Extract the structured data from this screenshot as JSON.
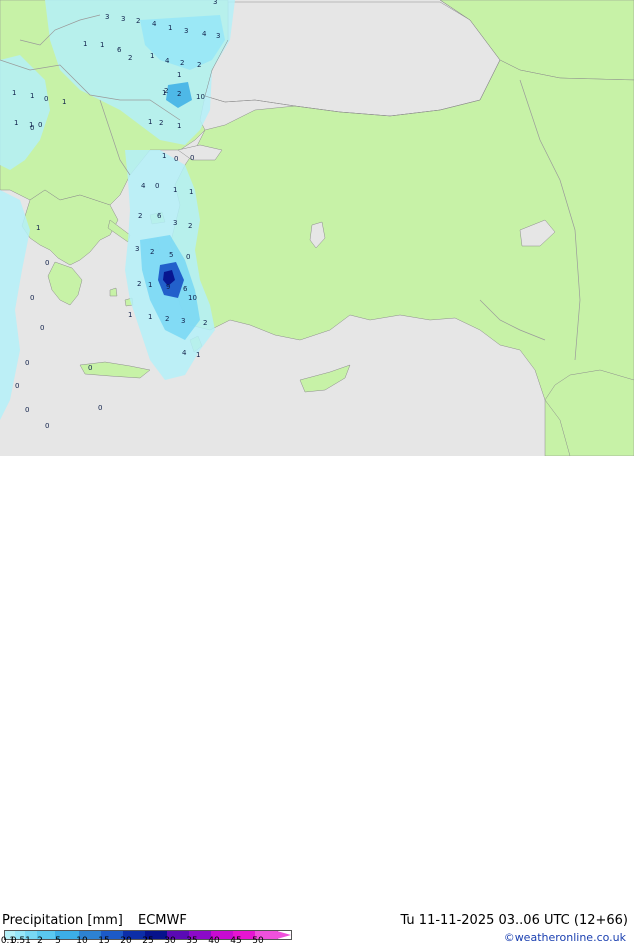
{
  "footer": {
    "title": "Precipitation [mm]",
    "model": "ECMWF",
    "valid": "Tu 11-11-2025 03..06 UTC (12+66)",
    "credit": "©weatheronline.co.uk"
  },
  "legend": {
    "ticks": [
      "0.1",
      "0.5",
      "1",
      "2",
      "5",
      "10",
      "15",
      "20",
      "25",
      "30",
      "35",
      "40",
      "45",
      "50"
    ],
    "colors": [
      "#b4f0f8",
      "#96e6f8",
      "#78d7f4",
      "#5ac8f0",
      "#3caee6",
      "#2d82d2",
      "#1c5ac8",
      "#0c2ea8",
      "#06128c",
      "#5a0ab4",
      "#8c0ac8",
      "#c80ad2",
      "#e614d2",
      "#f050dc"
    ]
  },
  "map_colors": {
    "sea": "#e6e6e6",
    "land": "#c7f2a7",
    "border": "#9a9a9a",
    "coast": "#8c8c8c"
  },
  "precip_values": [
    "3",
    "3",
    "2",
    "4",
    "1",
    "3",
    "4",
    "3",
    "3",
    "1",
    "1",
    "6",
    "2",
    "1",
    "4",
    "2",
    "2",
    "1",
    "2",
    "1",
    "2",
    "10",
    "1",
    "2",
    "1",
    "0",
    "1",
    "1",
    "0",
    "1",
    "1",
    "1",
    "0",
    "4",
    "1",
    "1",
    "2",
    "6",
    "3",
    "2",
    "3",
    "2",
    "5",
    "0",
    "2",
    "1",
    "9",
    "6",
    "10",
    "1",
    "1",
    "2",
    "3",
    "2",
    "4",
    "1",
    "0",
    "1",
    "0",
    "0",
    "1",
    "0",
    "0",
    "0",
    "0",
    "0",
    "0",
    "0",
    "0",
    "0"
  ]
}
